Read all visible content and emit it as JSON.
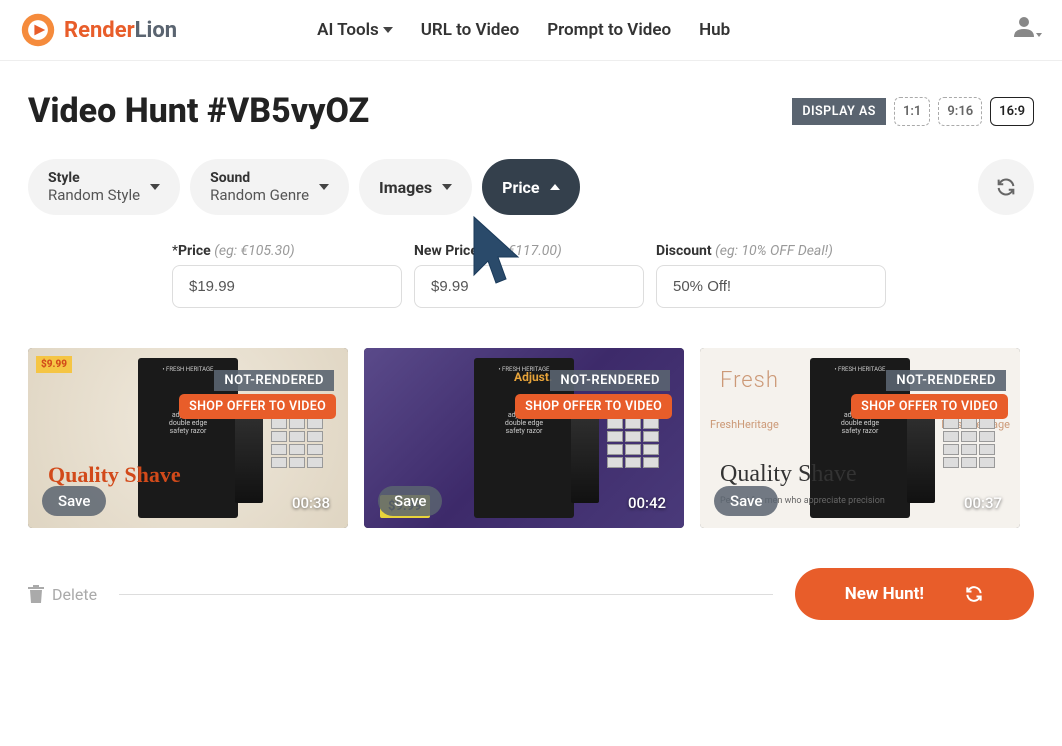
{
  "header": {
    "logo_part1": "Render",
    "logo_part2": "Lion",
    "nav": {
      "ai_tools": "AI Tools",
      "url_to_video": "URL to Video",
      "prompt_to_video": "Prompt to Video",
      "hub": "Hub"
    }
  },
  "page": {
    "title": "Video Hunt #VB5vyOZ"
  },
  "display": {
    "label": "DISPLAY AS",
    "ratios": [
      "1:1",
      "9:16",
      "16:9"
    ],
    "active": "16:9"
  },
  "filters": {
    "style": {
      "label": "Style",
      "value": "Random Style"
    },
    "sound": {
      "label": "Sound",
      "value": "Random Genre"
    },
    "images": {
      "label": "Images"
    },
    "price": {
      "label": "Price"
    }
  },
  "price_inputs": {
    "price": {
      "label": "Price",
      "hint": "(eg: €105.30)",
      "value": "$19.99",
      "required": "*"
    },
    "new_price": {
      "label": "New Price",
      "hint": "(eg: €117.00)",
      "value": "$9.99"
    },
    "discount": {
      "label": "Discount",
      "hint": "(eg: 10% OFF Deal!)",
      "value": "50% Off!"
    }
  },
  "cards": [
    {
      "not_rendered": "NOT-RENDERED",
      "shop": "SHOP OFFER TO VIDEO",
      "save": "Save",
      "duration": "00:38",
      "title": "Quality Shave",
      "corner": "$9.99"
    },
    {
      "not_rendered": "NOT-RENDERED",
      "shop": "SHOP OFFER TO VIDEO",
      "save": "Save",
      "duration": "00:42",
      "adjust": "Adjust.",
      "price_tag": "$9.99"
    },
    {
      "not_rendered": "NOT-RENDERED",
      "shop": "SHOP OFFER TO VIDEO",
      "save": "Save",
      "duration": "00:37",
      "title": "Quality Shave",
      "sub": "Perfect for men who appreciate precision",
      "hero": "Fresh",
      "hero_side": "FreshHeritage"
    }
  ],
  "footer": {
    "delete": "Delete",
    "new_hunt": "New Hunt!"
  }
}
